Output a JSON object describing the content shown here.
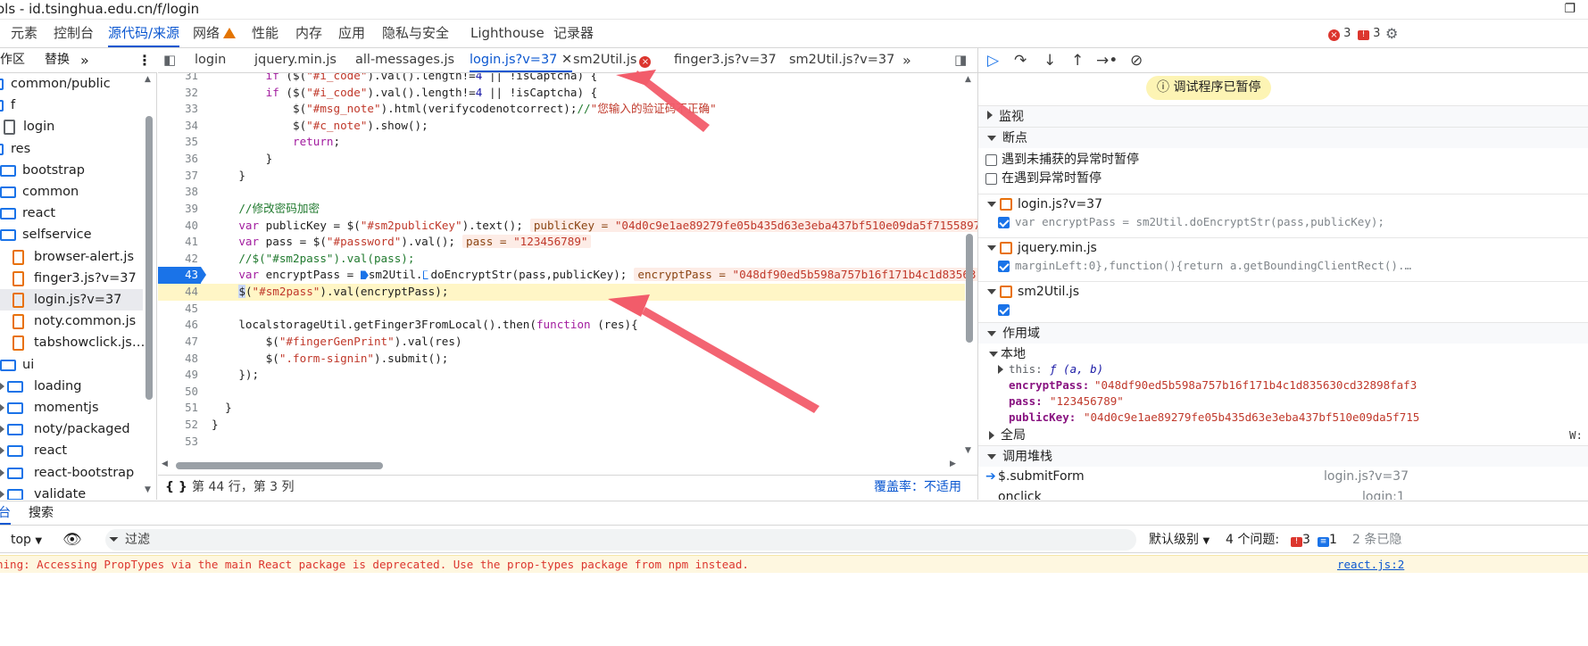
{
  "window": {
    "title": "ols - id.tsinghua.edu.cn/f/login",
    "maximize": "❐"
  },
  "main_tabs": [
    "元素",
    "控制台",
    "源代码/来源",
    "网络",
    "性能",
    "内存",
    "应用",
    "隐私与安全",
    "Lighthouse",
    "记录器"
  ],
  "issues": {
    "errors": "3",
    "messages": "3"
  },
  "navigator": {
    "tabs": [
      "作区",
      "替换"
    ],
    "tree": [
      {
        "label": "common/public",
        "type": "folder-root",
        "depth": 0
      },
      {
        "label": "f",
        "type": "folder-root",
        "depth": 0
      },
      {
        "label": "login",
        "type": "file",
        "depth": 1
      },
      {
        "label": "res",
        "type": "folder-root",
        "depth": 0
      },
      {
        "label": "bootstrap",
        "type": "folder",
        "depth": 1
      },
      {
        "label": "common",
        "type": "folder",
        "depth": 1
      },
      {
        "label": "react",
        "type": "folder",
        "depth": 1
      },
      {
        "label": "selfservice",
        "type": "folder",
        "depth": 1
      },
      {
        "label": "browser-alert.js",
        "type": "js",
        "depth": 2
      },
      {
        "label": "finger3.js?v=37",
        "type": "js",
        "depth": 2
      },
      {
        "label": "login.js?v=37",
        "type": "js",
        "depth": 2,
        "selected": true
      },
      {
        "label": "noty.common.js",
        "type": "js",
        "depth": 2
      },
      {
        "label": "tabshowclick.js…",
        "type": "js",
        "depth": 2
      },
      {
        "label": "ui",
        "type": "folder",
        "depth": 1
      },
      {
        "label": "loading",
        "type": "folder",
        "depth": 2
      },
      {
        "label": "momentjs",
        "type": "folder",
        "depth": 2
      },
      {
        "label": "noty/packaged",
        "type": "folder",
        "depth": 2
      },
      {
        "label": "react",
        "type": "folder",
        "depth": 2
      },
      {
        "label": "react-bootstrap",
        "type": "folder",
        "depth": 2
      },
      {
        "label": "validate",
        "type": "folder",
        "depth": 2
      }
    ]
  },
  "editor": {
    "tabs": [
      {
        "label": "login"
      },
      {
        "label": "jquery.min.js"
      },
      {
        "label": "all-messages.js"
      },
      {
        "label": "login.js?v=37",
        "active": true
      },
      {
        "label": "sm2Util.js",
        "error": true
      },
      {
        "label": "finger3.js?v=37"
      },
      {
        "label": "sm2Util.js?v=37"
      }
    ],
    "status_position": "第 44 行，第 3 列",
    "coverage": "覆盖率：不适用",
    "code_lines": [
      {
        "n": "31",
        "text": "        if ($(\"#i_code\").val().length!=4 || !isCaptcha) {"
      },
      {
        "n": "32",
        "text": "        if ($(\"#i_code\").val().length!=4 || !isCaptcha) {"
      },
      {
        "n": "33",
        "text": "            $(\"#msg_note\").html(verifycodenotcorrect);//\"您输入的验证码不正确\""
      },
      {
        "n": "34",
        "text": "            $(\"#c_note\").show();"
      },
      {
        "n": "35",
        "text": "            return;"
      },
      {
        "n": "36",
        "text": "        }"
      },
      {
        "n": "37",
        "text": "    }"
      },
      {
        "n": "38",
        "text": ""
      },
      {
        "n": "39",
        "text": "    //修改密码加密"
      },
      {
        "n": "40",
        "text": "    var publicKey = $(\"#sm2publicKey\").text();",
        "inline": "publicKey = \"04d0c9e1ae89279fe05b435d63e3eba437bf510e09da5f7155897"
      },
      {
        "n": "41",
        "text": "    var pass = $(\"#password\").val();",
        "inline": "pass = \"123456789\""
      },
      {
        "n": "42",
        "text": "    //$(\"#sm2pass\").val(pass);"
      },
      {
        "n": "43",
        "text": "    var encryptPass = sm2Util.doEncryptStr(pass,publicKey);",
        "inline": "encryptPass = \"048df90ed5b598a757b16f171b4c1d83563",
        "breakpoint": true
      },
      {
        "n": "44",
        "text": "    $(\"#sm2pass\").val(encryptPass);",
        "current": true
      },
      {
        "n": "45",
        "text": ""
      },
      {
        "n": "46",
        "text": "    localstorageUtil.getFinger3FromLocal().then(function (res){"
      },
      {
        "n": "47",
        "text": "        $(\"#fingerGenPrint\").val(res)"
      },
      {
        "n": "48",
        "text": "        $(\".form-signin\").submit();"
      },
      {
        "n": "49",
        "text": "    });"
      },
      {
        "n": "50",
        "text": ""
      },
      {
        "n": "51",
        "text": "  }"
      },
      {
        "n": "52",
        "text": "}"
      },
      {
        "n": "53",
        "text": ""
      }
    ]
  },
  "debugger": {
    "paused_label": "调试程序已暂停",
    "sections": {
      "watch": "监视",
      "breakpoints": "断点",
      "scope": "作用域",
      "callstack": "调用堆栈"
    },
    "pause_uncaught": "遇到未捕获的异常时暂停",
    "pause_caught": "在遇到异常时暂停",
    "breakpoints": [
      {
        "file": "login.js?v=37",
        "code": "var encryptPass = sm2Util.doEncryptStr(pass,publicKey);"
      },
      {
        "file": "jquery.min.js",
        "code": "marginLeft:0},function(){return a.getBoundingClientRect().…"
      },
      {
        "file": "sm2Util.js",
        "code": ""
      }
    ],
    "scope": {
      "local_label": "本地",
      "this_label": "this:",
      "this_value": "ƒ (a, b)",
      "vars": [
        {
          "key": "encryptPass:",
          "value": "\"048df90ed5b598a757b16f171b4c1d835630cd32898faf3"
        },
        {
          "key": "pass:",
          "value": "\"123456789\""
        },
        {
          "key": "publicKey:",
          "value": "\"04d0c9e1ae89279fe05b435d63e3eba437bf510e09da5f715"
        }
      ],
      "global_label": "全局",
      "global_value": "W:"
    },
    "callstack": [
      {
        "fn": "$.submitForm",
        "loc": "login.js?v=37"
      },
      {
        "fn": "onclick",
        "loc": "login:1"
      }
    ]
  },
  "drawer": {
    "tabs": [
      "台",
      "搜索"
    ],
    "context": "top",
    "filter_placeholder": "过滤",
    "level": "默认级别",
    "issues_label": "4 个问题:",
    "issues_err": "3",
    "issues_info": "1",
    "hidden": "2 条已隐",
    "warning": "ning: Accessing PropTypes via the main React package is deprecated. Use the prop-types package from npm instead.",
    "warning_src": "react.js:2"
  },
  "colors": {
    "accent": "#0b57d0",
    "error": "#dc362e",
    "annotation": "#f25c6a"
  }
}
